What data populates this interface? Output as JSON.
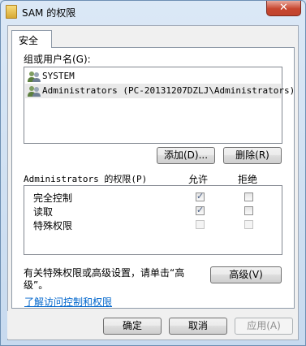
{
  "window": {
    "title": "SAM 的权限",
    "close_glyph": "✕"
  },
  "tab": {
    "label": "安全"
  },
  "users": {
    "heading": "组或用户名(G):",
    "items": [
      {
        "label": "SYSTEM",
        "icon": "user-group-icon",
        "selected": false
      },
      {
        "label": "Administrators (PC-20131207DZLJ\\Administrators)",
        "icon": "user-group-icon",
        "selected": true
      }
    ]
  },
  "buttons": {
    "add": "添加(D)...",
    "remove": "删除(R)",
    "advanced": "高级(V)",
    "ok": "确定",
    "cancel": "取消",
    "apply": "应用(A)"
  },
  "permissions": {
    "heading": "Administrators 的权限(P)",
    "allow_header": "允许",
    "deny_header": "拒绝",
    "rows": [
      {
        "label": "完全控制",
        "allow": true,
        "deny": false,
        "allow_dim": false,
        "deny_dim": false
      },
      {
        "label": "读取",
        "allow": true,
        "deny": false,
        "allow_dim": false,
        "deny_dim": false
      },
      {
        "label": "特殊权限",
        "allow": false,
        "deny": false,
        "allow_dim": true,
        "deny_dim": true
      }
    ]
  },
  "advanced_note": {
    "line1": "有关特殊权限或高级设置，请单击“高",
    "line2": "级”。"
  },
  "help_link": "了解访问控制和权限"
}
